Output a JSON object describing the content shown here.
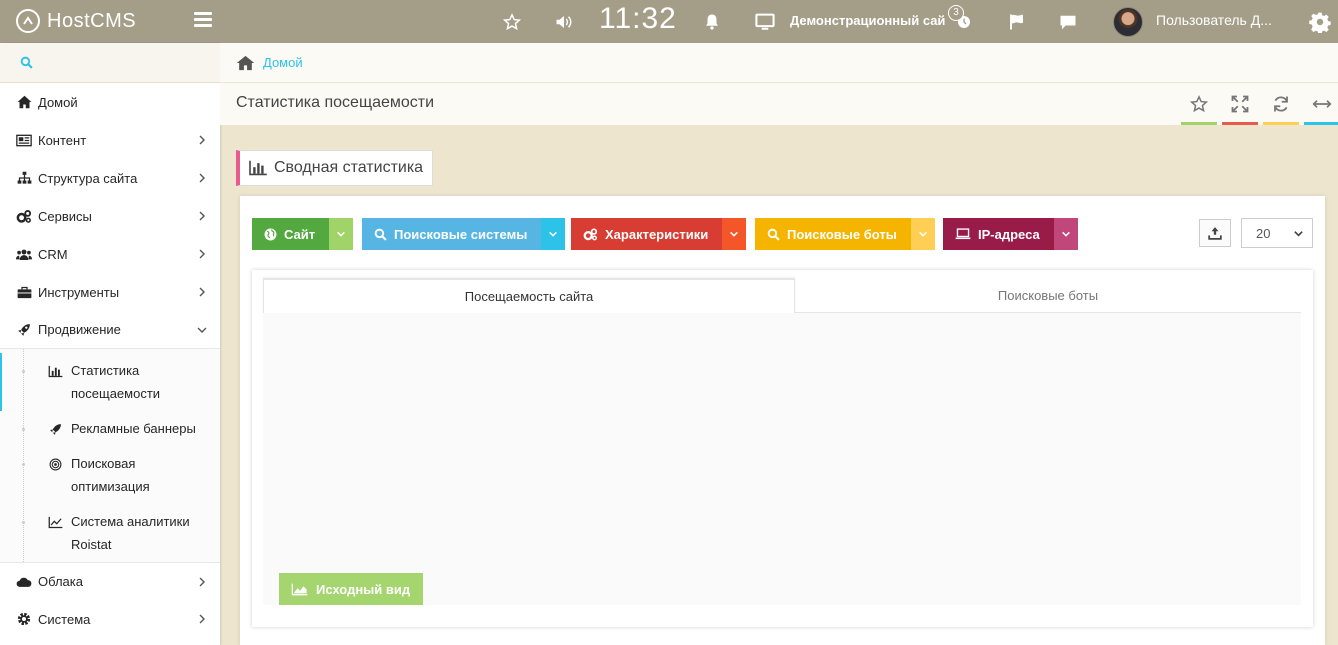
{
  "topbar": {
    "logo_text": "HostCMS",
    "clock": "11:32",
    "site_name": "Демонстрационный сай",
    "notification_count": "3",
    "username": "Пользователь Д..."
  },
  "sidebar": {
    "items": [
      {
        "label": "Домой",
        "icon": "home-icon"
      },
      {
        "label": "Контент",
        "icon": "newspaper-icon"
      },
      {
        "label": "Структура сайта",
        "icon": "sitemap-icon"
      },
      {
        "label": "Сервисы",
        "icon": "cogs-icon"
      },
      {
        "label": "CRM",
        "icon": "users-icon"
      },
      {
        "label": "Инструменты",
        "icon": "briefcase-icon"
      },
      {
        "label": "Продвижение",
        "icon": "rocket-icon"
      }
    ],
    "submenu": [
      {
        "label": "Статистика посещаемости",
        "icon": "bar-chart-icon",
        "active": true
      },
      {
        "label": "Рекламные баннеры",
        "icon": "rocket-icon"
      },
      {
        "label": "Поисковая оптимизация",
        "icon": "bullseye-icon"
      },
      {
        "label": "Система аналитики Roistat",
        "icon": "line-chart-icon"
      }
    ],
    "items_after": [
      {
        "label": "Облака",
        "icon": "cloud-icon"
      },
      {
        "label": "Система",
        "icon": "gear-icon"
      }
    ]
  },
  "breadcrumb": {
    "home": "Домой"
  },
  "header": {
    "title": "Статистика посещаемости",
    "button_bar_colors": [
      "#a0d468",
      "#e75b4d",
      "#ffce55",
      "#2dc3e8"
    ]
  },
  "widget": {
    "caption": "Сводная статистика",
    "caption_accent": "#e75b8d",
    "buttons": [
      {
        "label": "Сайт",
        "icon": "globe-icon",
        "color": "#53a93f",
        "drop_color": "#a0d468"
      },
      {
        "label": "Поисковые системы",
        "icon": "search-icon",
        "color": "#57b5e3",
        "drop_color": "#2dc3e8"
      },
      {
        "label": "Характеристики",
        "icon": "cogs-icon",
        "color": "#d73d32",
        "drop_color": "#f4562a"
      },
      {
        "label": "Поисковые боты",
        "icon": "search-icon",
        "color": "#f4b400",
        "drop_color": "#ffce55"
      },
      {
        "label": "IP-адреса",
        "icon": "laptop-icon",
        "color": "#981b48",
        "drop_color": "#c1477a"
      }
    ],
    "per_page": "20",
    "tabs": [
      "Посещаемость сайта",
      "Поисковые боты"
    ],
    "reset_button": "Исходный вид"
  }
}
